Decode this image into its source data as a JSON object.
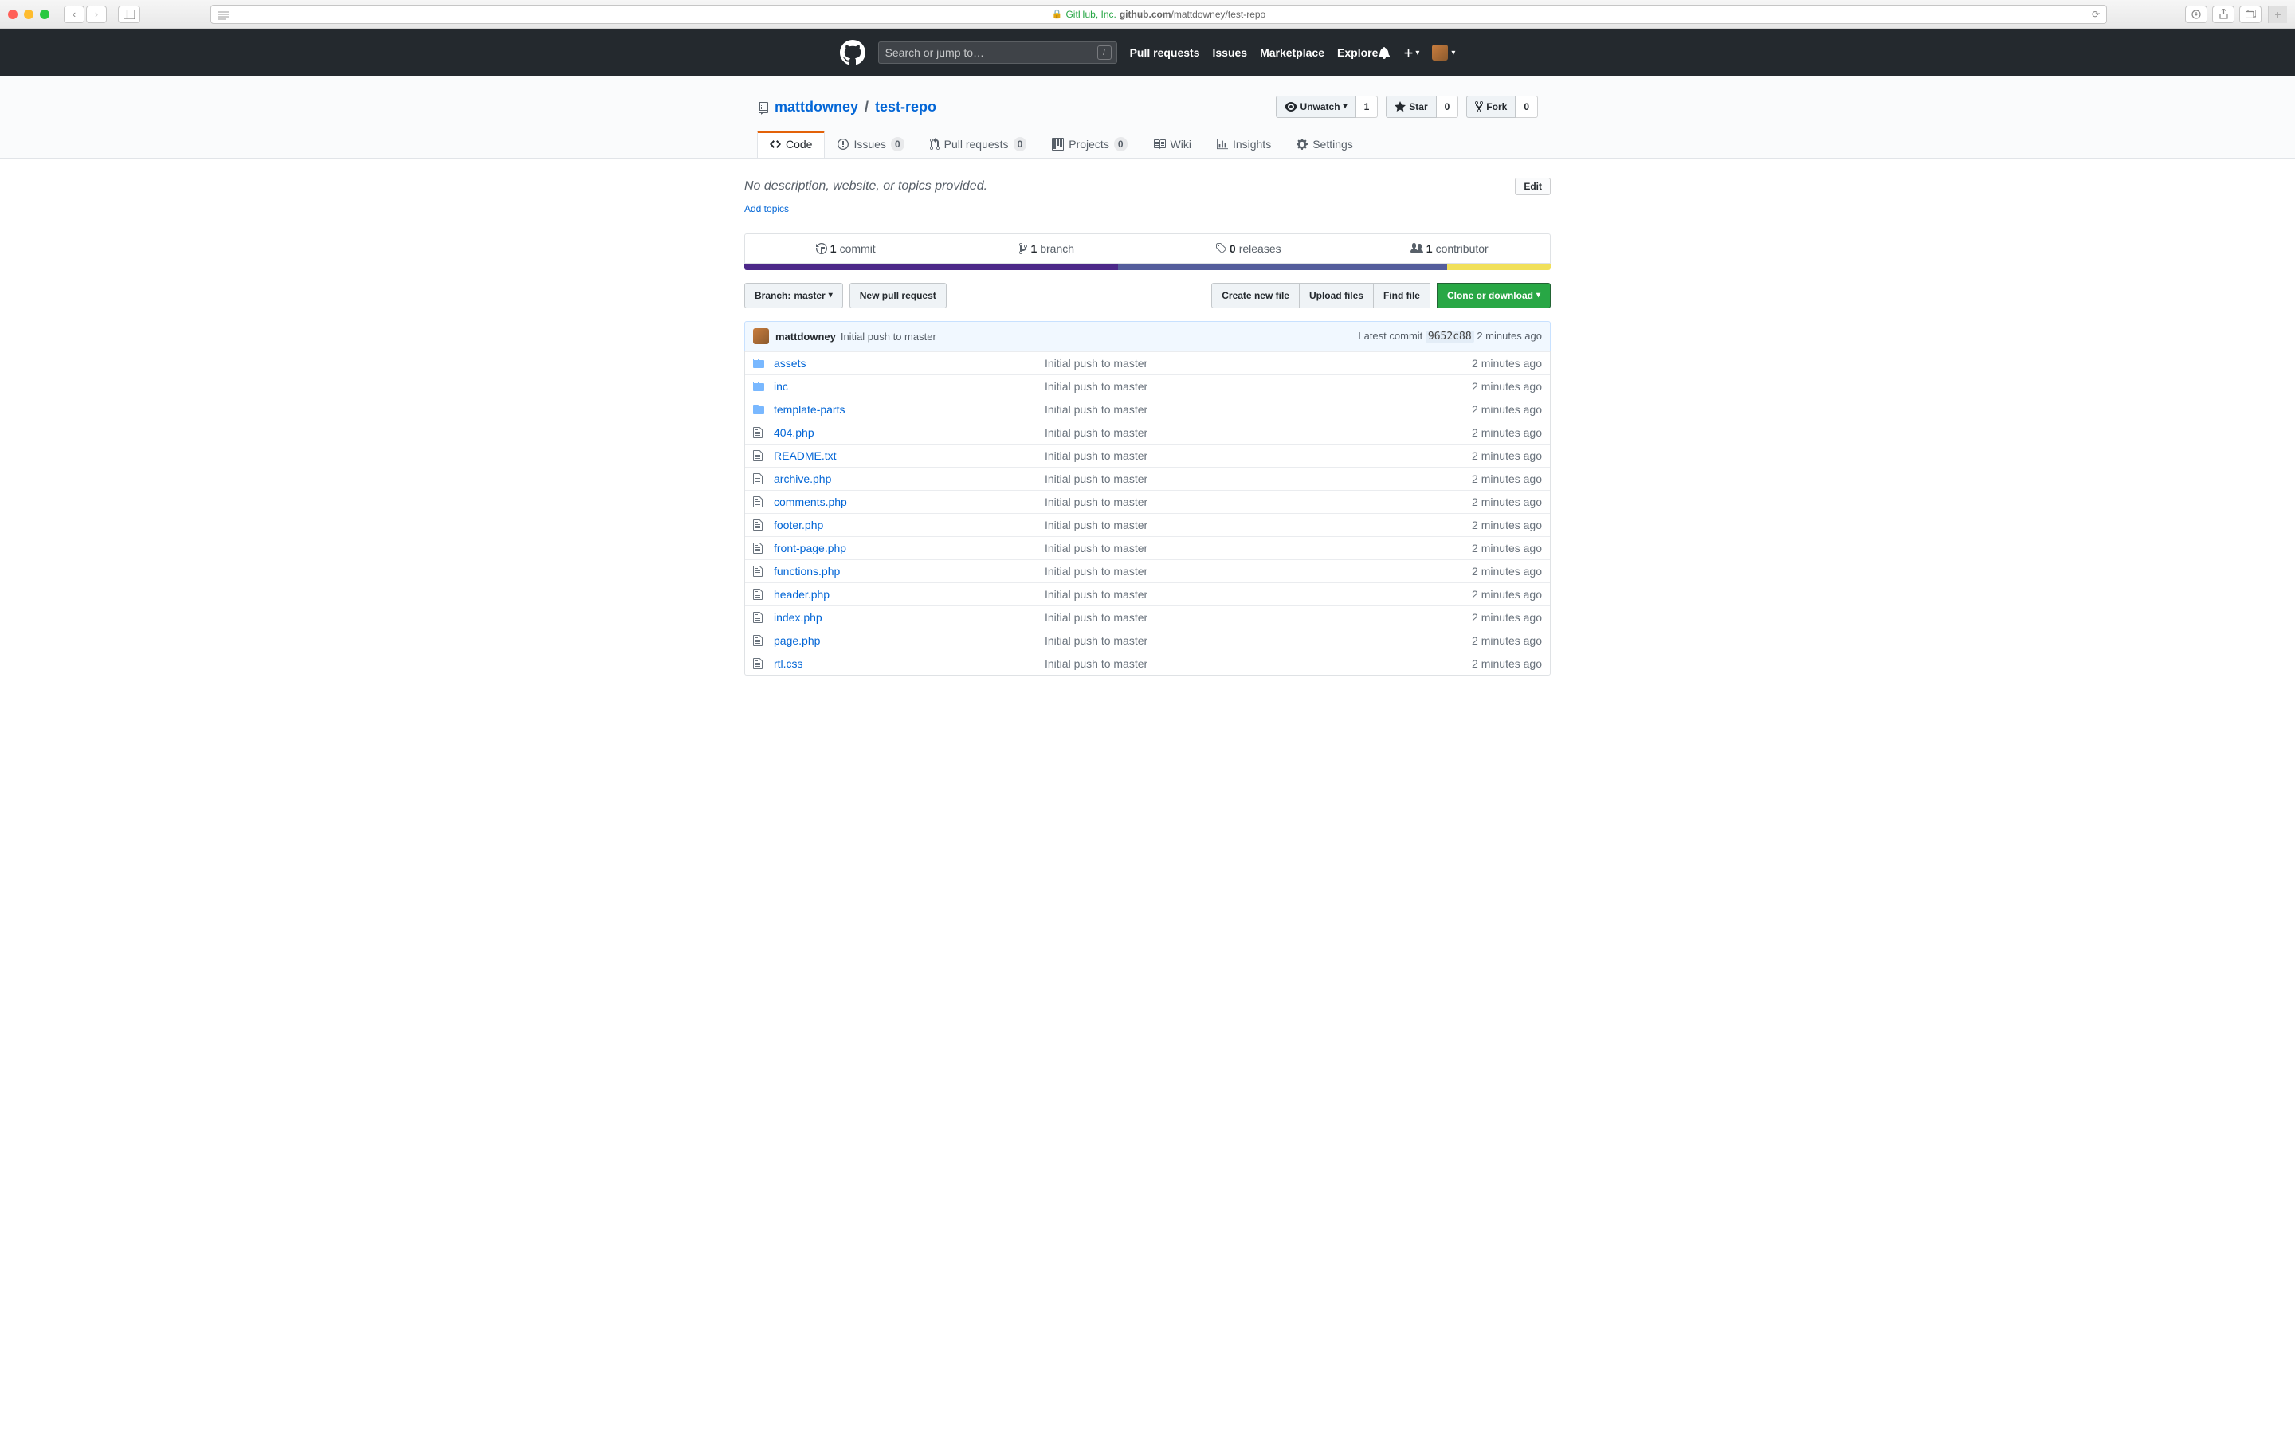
{
  "browser": {
    "url_secure_prefix": "GitHub, Inc.",
    "url_domain": "github.com",
    "url_path": "/mattdowney/test-repo"
  },
  "header": {
    "search_placeholder": "Search or jump to…",
    "nav": {
      "pulls": "Pull requests",
      "issues": "Issues",
      "marketplace": "Marketplace",
      "explore": "Explore"
    }
  },
  "repo": {
    "owner": "mattdowney",
    "name": "test-repo",
    "actions": {
      "unwatch": "Unwatch",
      "unwatch_count": "1",
      "star": "Star",
      "star_count": "0",
      "fork": "Fork",
      "fork_count": "0"
    }
  },
  "tabs": {
    "code": "Code",
    "issues": "Issues",
    "issues_count": "0",
    "pulls": "Pull requests",
    "pulls_count": "0",
    "projects": "Projects",
    "projects_count": "0",
    "wiki": "Wiki",
    "insights": "Insights",
    "settings": "Settings"
  },
  "description": {
    "text": "No description, website, or topics provided.",
    "add_topics": "Add topics",
    "edit": "Edit"
  },
  "summary": {
    "commits_num": "1",
    "commits_label": "commit",
    "branch_num": "1",
    "branch_label": "branch",
    "releases_num": "0",
    "releases_label": "releases",
    "contributors_num": "1",
    "contributors_label": "contributor"
  },
  "file_nav": {
    "branch_label": "Branch:",
    "branch_name": "master",
    "new_pr": "New pull request",
    "create_file": "Create new file",
    "upload_files": "Upload files",
    "find_file": "Find file",
    "clone": "Clone or download"
  },
  "commit": {
    "author": "mattdowney",
    "message": "Initial push to master",
    "latest_label": "Latest commit",
    "sha": "9652c88",
    "time": "2 minutes ago"
  },
  "files": [
    {
      "type": "folder",
      "name": "assets",
      "msg": "Initial push to master",
      "time": "2 minutes ago"
    },
    {
      "type": "folder",
      "name": "inc",
      "msg": "Initial push to master",
      "time": "2 minutes ago"
    },
    {
      "type": "folder",
      "name": "template-parts",
      "msg": "Initial push to master",
      "time": "2 minutes ago"
    },
    {
      "type": "file",
      "name": "404.php",
      "msg": "Initial push to master",
      "time": "2 minutes ago"
    },
    {
      "type": "file",
      "name": "README.txt",
      "msg": "Initial push to master",
      "time": "2 minutes ago"
    },
    {
      "type": "file",
      "name": "archive.php",
      "msg": "Initial push to master",
      "time": "2 minutes ago"
    },
    {
      "type": "file",
      "name": "comments.php",
      "msg": "Initial push to master",
      "time": "2 minutes ago"
    },
    {
      "type": "file",
      "name": "footer.php",
      "msg": "Initial push to master",
      "time": "2 minutes ago"
    },
    {
      "type": "file",
      "name": "front-page.php",
      "msg": "Initial push to master",
      "time": "2 minutes ago"
    },
    {
      "type": "file",
      "name": "functions.php",
      "msg": "Initial push to master",
      "time": "2 minutes ago"
    },
    {
      "type": "file",
      "name": "header.php",
      "msg": "Initial push to master",
      "time": "2 minutes ago"
    },
    {
      "type": "file",
      "name": "index.php",
      "msg": "Initial push to master",
      "time": "2 minutes ago"
    },
    {
      "type": "file",
      "name": "page.php",
      "msg": "Initial push to master",
      "time": "2 minutes ago"
    },
    {
      "type": "file",
      "name": "rtl.css",
      "msg": "Initial push to master",
      "time": "2 minutes ago"
    }
  ]
}
